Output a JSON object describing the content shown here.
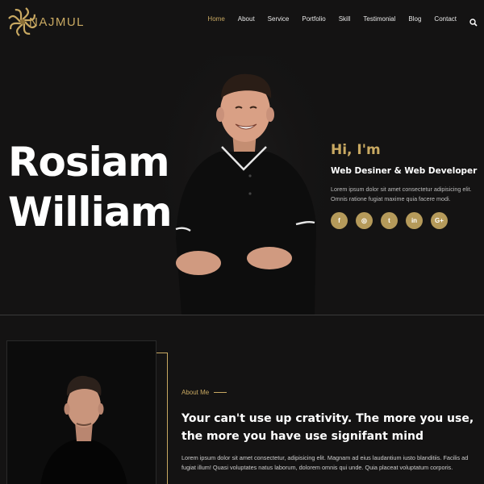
{
  "brand": {
    "logo_text": "NAJMUL",
    "accent": "#c9a962",
    "background": "#141313"
  },
  "nav": {
    "items": [
      {
        "label": "Home",
        "active": true
      },
      {
        "label": "About"
      },
      {
        "label": "Service"
      },
      {
        "label": "Portfolio"
      },
      {
        "label": "Skill"
      },
      {
        "label": "Testimonial"
      },
      {
        "label": "Blog"
      },
      {
        "label": "Contact"
      }
    ],
    "search_icon": "search-icon"
  },
  "hero": {
    "first_name": "Rosiam",
    "last_name": "William",
    "greeting": "Hi, I'm",
    "role": "Web Desiner & Web Developer",
    "intro": "Lorem ipsum dolor sit amet consectetur adipisicing elit. Omnis ratione fugiat maxime quia facere modi.",
    "socials": [
      {
        "icon": "facebook-icon",
        "glyph": "f"
      },
      {
        "icon": "instagram-icon",
        "glyph": "◎"
      },
      {
        "icon": "twitter-icon",
        "glyph": "t"
      },
      {
        "icon": "linkedin-icon",
        "glyph": "in"
      },
      {
        "icon": "google-plus-icon",
        "glyph": "G+"
      }
    ]
  },
  "about": {
    "label": "About Me",
    "heading": "Your can't use up crativity. The more you use, the more you have use signifant mind",
    "text": "Lorem ipsum dolor sit amet consectetur, adipisicing elit. Magnam ad eius laudantium iusto blanditiis. Facilis ad fugiat illum! Quasi voluptates natus laborum, dolorem omnis qui unde. Quia placeat voluptatum corporis."
  }
}
